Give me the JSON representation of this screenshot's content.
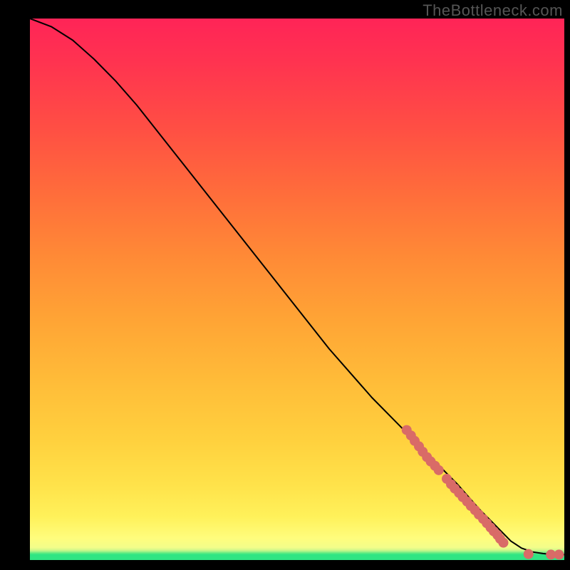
{
  "watermark": "TheBottleneck.com",
  "chart_data": {
    "type": "line",
    "title": "",
    "xlabel": "",
    "ylabel": "",
    "xlim": [
      0,
      100
    ],
    "ylim": [
      0,
      100
    ],
    "curve": {
      "name": "bottleneck-curve",
      "x": [
        0,
        4,
        8,
        12,
        16,
        20,
        24,
        28,
        32,
        36,
        40,
        44,
        48,
        52,
        56,
        60,
        64,
        68,
        72,
        76,
        80,
        84,
        86,
        88,
        90,
        92,
        94,
        96,
        98,
        100
      ],
      "y": [
        100,
        98.5,
        96,
        92.5,
        88.5,
        84,
        79,
        74,
        69,
        64,
        59,
        54,
        49,
        44,
        39,
        34.5,
        30,
        26,
        22,
        18,
        14,
        9.5,
        7.5,
        5.5,
        3.5,
        2.2,
        1.5,
        1.2,
        1.0,
        1.0
      ]
    },
    "series": [
      {
        "name": "highlighted-points",
        "color": "#d96b67",
        "x": [
          70.5,
          71.3,
          72.0,
          72.8,
          73.5,
          74.3,
          75.0,
          75.8,
          76.5,
          78.0,
          78.8,
          79.5,
          80.3,
          81.0,
          81.8,
          82.5,
          83.3,
          84.0,
          84.8,
          85.5,
          86.2,
          86.8,
          87.5,
          88.0,
          88.6,
          93.3,
          97.5,
          99.0
        ],
        "y": [
          24.0,
          23.0,
          22.0,
          21.0,
          20.0,
          19.0,
          18.2,
          17.4,
          16.6,
          15.0,
          14.0,
          13.2,
          12.4,
          11.6,
          10.8,
          10.0,
          9.2,
          8.4,
          7.6,
          6.8,
          6.0,
          5.3,
          4.6,
          3.9,
          3.2,
          1.1,
          1.0,
          1.0
        ]
      }
    ],
    "gradient_stops": [
      {
        "pos": 0.0,
        "color": "#2fe583"
      },
      {
        "pos": 0.02,
        "color": "#f2fd8a"
      },
      {
        "pos": 0.08,
        "color": "#fff15a"
      },
      {
        "pos": 0.5,
        "color": "#ff9a35"
      },
      {
        "pos": 1.0,
        "color": "#ff2457"
      }
    ]
  }
}
